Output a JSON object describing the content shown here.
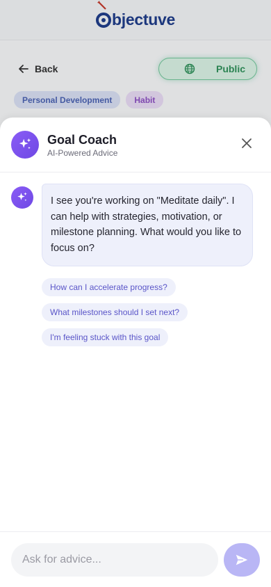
{
  "background": {
    "logo_text": "bjectuve",
    "back_label": "Back",
    "visibility_label": "Public",
    "tags": [
      "Personal Development",
      "Habit"
    ]
  },
  "coach": {
    "title": "Goal Coach",
    "subtitle": "AI-Powered Advice"
  },
  "message": {
    "text": "I see you're working on \"Meditate daily\". I can help with strategies, motivation, or milestone planning. What would you like to focus on?"
  },
  "suggestions": [
    "How can I accelerate progress?",
    "What milestones should I set next?",
    "I'm feeling stuck with this goal"
  ],
  "composer": {
    "placeholder": "Ask for advice..."
  },
  "colors": {
    "accent": "#7c5cf0",
    "bubble": "#eef0fb",
    "send": "#b9b6f5",
    "public_green": "#2f8f5a"
  },
  "icons": {
    "coach": "sparkles-icon",
    "close": "close-icon",
    "send": "send-icon",
    "back": "arrow-left-icon",
    "public": "globe-icon"
  }
}
